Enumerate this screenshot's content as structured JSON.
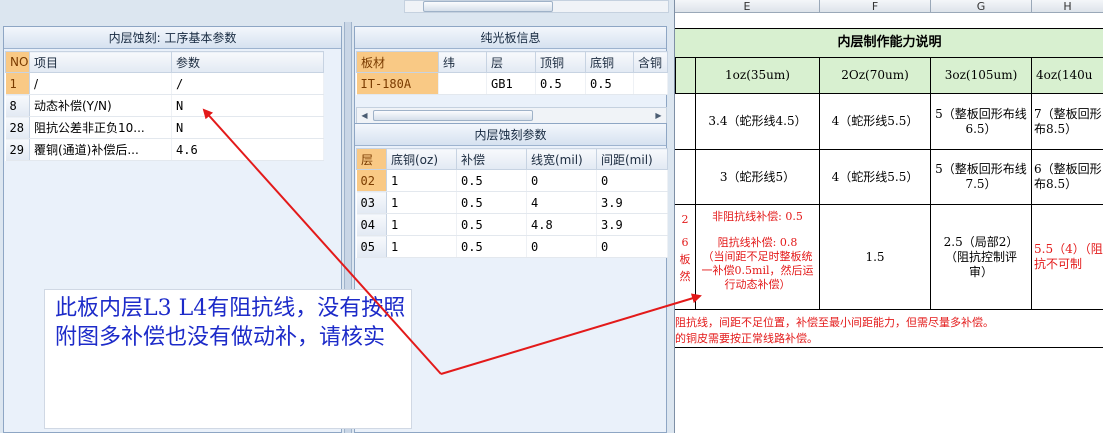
{
  "panel_basic": {
    "title": "内层蚀刻: 工序基本参数",
    "headers": [
      "NO",
      "项目",
      "参数"
    ],
    "rows": [
      {
        "no": "1",
        "item": "/",
        "value": "/"
      },
      {
        "no": "8",
        "item": "动态补偿(Y/N)",
        "value": "N"
      },
      {
        "no": "28",
        "item": "阻抗公差非正负10...",
        "value": "N"
      },
      {
        "no": "29",
        "item": "覆铜(通道)补偿后...",
        "value": "4.6"
      }
    ]
  },
  "panel_board": {
    "title": "纯光板信息",
    "headers": [
      "板材",
      "纬",
      "层",
      "顶铜",
      "底铜",
      "含铜"
    ],
    "rows": [
      {
        "material": "IT-180A",
        "weft": "",
        "layer": "GB1",
        "top_cu": "0.5",
        "bottom_cu": "0.5",
        "cu": ""
      }
    ]
  },
  "panel_etch": {
    "title": "内层蚀刻参数",
    "headers": [
      "层",
      "底铜(oz)",
      "补偿",
      "线宽(mil)",
      "间距(mil)"
    ],
    "rows": [
      {
        "layer": "02",
        "base_cu": "1",
        "comp": "0.5",
        "width": "0",
        "spacing": "0"
      },
      {
        "layer": "03",
        "base_cu": "1",
        "comp": "0.5",
        "width": "4",
        "spacing": "3.9"
      },
      {
        "layer": "04",
        "base_cu": "1",
        "comp": "0.5",
        "width": "4.8",
        "spacing": "3.9"
      },
      {
        "layer": "05",
        "base_cu": "1",
        "comp": "0.5",
        "width": "0",
        "spacing": "0"
      }
    ]
  },
  "sheet": {
    "columns": [
      "E",
      "F",
      "G",
      "H"
    ],
    "title": "内层制作能力说明",
    "headers": [
      "1oz(35um)",
      "2Oz(70um)",
      "3oz(105um)",
      "4oz(140u"
    ],
    "row1": {
      "e": "3.4（蛇形线4.5）",
      "f": "4（蛇形线5.5）",
      "g": "5（整板回形布线6.5）",
      "h": "7（整板回形布8.5）"
    },
    "row2": {
      "e": "3（蛇形线5）",
      "f": "4（蛇形线5.5）",
      "g": "5（整板回形布线7.5）",
      "h": "6（整板回形布8.5）"
    },
    "row3": {
      "left_edge": [
        "2",
        "6",
        "板",
        "然"
      ],
      "e_line1": "非阻抗线补偿: 0.5",
      "e_line2": "阻抗线补偿:  0.8",
      "e_line3": "（当间距不足时整板统一补偿0.5mil，然后运行动态补偿）",
      "f": "1.5",
      "g": "2.5（局部2）（阻抗控制评审）",
      "h": "5.5（4）（阻抗不可制"
    },
    "note1": "阻抗线，间距不足位置，补偿至最小间距能力，但需尽量多补偿。",
    "note2": "的铜皮需要按正常线路补偿。"
  },
  "callout": {
    "text": "此板内层L3  L4有阻抗线，没有按照附图多补偿也没有做动补，请核实"
  },
  "colors": {
    "callout_text": "#1d2bc9",
    "arrow": "#e31a1a",
    "header_green": "#d8f0d0",
    "selection": "#f9c985"
  }
}
